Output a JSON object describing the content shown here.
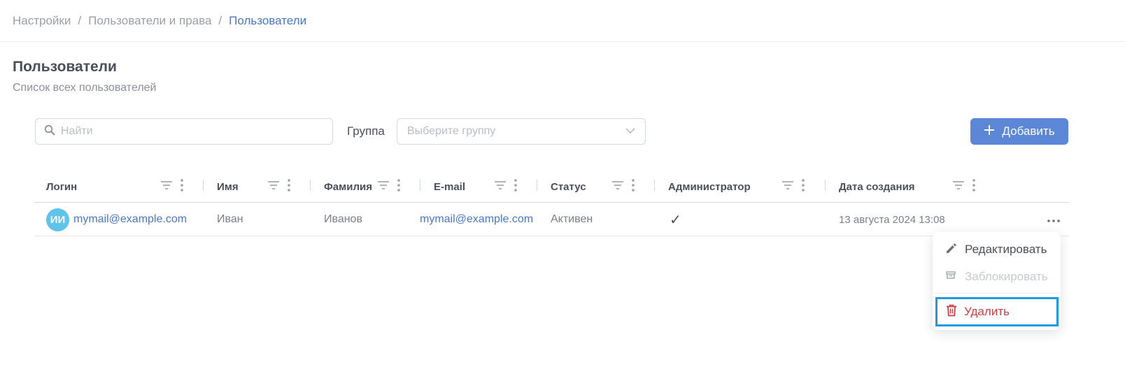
{
  "breadcrumb": {
    "items": [
      "Настройки",
      "Пользователи и права",
      "Пользователи"
    ],
    "separator": "/"
  },
  "page": {
    "title": "Пользователи",
    "subtitle": "Список всех пользователей"
  },
  "search": {
    "placeholder": "Найти",
    "icon": "search-icon"
  },
  "group_filter": {
    "label": "Группа",
    "placeholder": "Выберите группу",
    "icon": "chevron-down-icon"
  },
  "add_button": {
    "label": "Добавить",
    "icon": "plus-icon"
  },
  "table": {
    "columns": [
      "Логин",
      "Имя",
      "Фамилия",
      "E-mail",
      "Статус",
      "Администратор",
      "Дата создания"
    ],
    "rows": [
      {
        "avatar_initials": "ИИ",
        "login": "mymail@example.com",
        "first_name": "Иван",
        "last_name": "Иванов",
        "email": "mymail@example.com",
        "status": "Активен",
        "admin": "✓",
        "created": "13 августа 2024 13:08"
      }
    ]
  },
  "row_menu": {
    "items": [
      {
        "label": "Редактировать",
        "icon": "pencil-icon",
        "enabled": true
      },
      {
        "label": "Заблокировать",
        "icon": "archive-icon",
        "enabled": false
      },
      {
        "label": "Удалить",
        "icon": "trash-icon",
        "enabled": true,
        "highlighted": true
      }
    ]
  },
  "colors": {
    "accent": "#5b87d6",
    "link": "#4a78c9",
    "danger": "#d23c42",
    "highlight_border": "#1e9be0",
    "avatar_bg": "#5fc3ea"
  }
}
